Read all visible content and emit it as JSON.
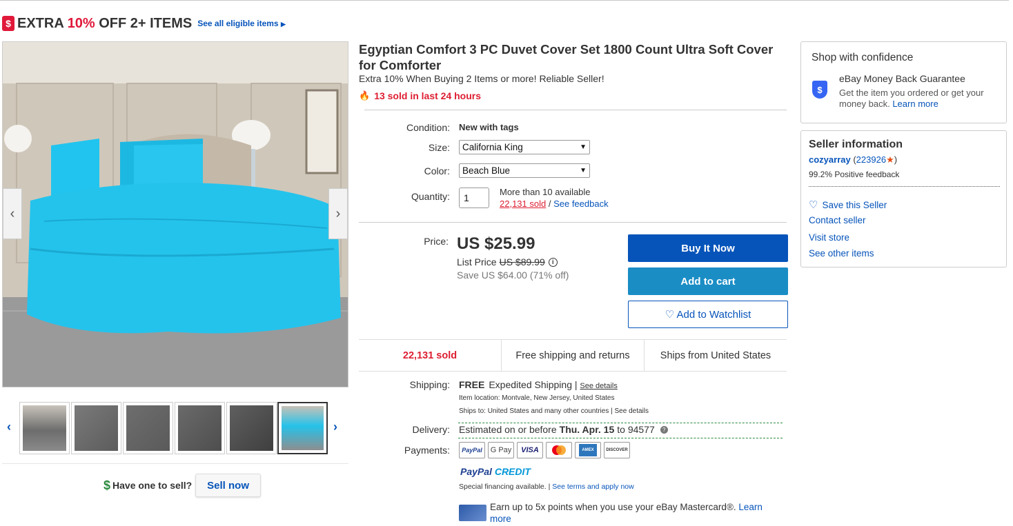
{
  "promo": {
    "text_pre": "EXTRA ",
    "text_pct": "10%",
    "text_post": " OFF 2+ ITEMS",
    "eligible_link": "See all eligible items",
    "icon": "$"
  },
  "product": {
    "title": "Egyptian Comfort 3 PC Duvet Cover Set 1800 Count Ultra Soft Cover for Comforter",
    "subtitle": "Extra 10% When Buying 2 Items or more! Reliable Seller!",
    "sold_24": "13 sold in last 24 hours"
  },
  "options": {
    "condition_label": "Condition:",
    "condition_value": "New with tags",
    "size_label": "Size:",
    "size_value": "California King",
    "color_label": "Color:",
    "color_value": "Beach Blue",
    "quantity_label": "Quantity:",
    "quantity_value": "1",
    "available": "More than 10 available",
    "sold_link": "22,131 sold",
    "slash": " / ",
    "feedback_link": "See feedback"
  },
  "pricing": {
    "price_label": "Price:",
    "price": "US $25.99",
    "list_price_label": "List Price",
    "list_price": "US $89.99",
    "save": "Save US $64.00 (71% off)"
  },
  "actions": {
    "buy_now": "Buy It Now",
    "add_to_cart": "Add to cart",
    "watchlist": "♡ Add to Watchlist"
  },
  "strip": {
    "sold": "22,131 sold",
    "shipping": "Free shipping and returns",
    "ships_from": "Ships from United States"
  },
  "shipping": {
    "label": "Shipping:",
    "free": "FREE",
    "method": "Expedited Shipping | ",
    "see_details": "See details",
    "location": "Item location:  Montvale, New Jersey, United States",
    "ships_to_pre": "Ships to:  United States and many other countries | ",
    "ships_to_link": "See details"
  },
  "delivery": {
    "label": "Delivery:",
    "pre": "Estimated on or before",
    "date": "Thu. Apr. 15",
    "post": "to 94577",
    "help": "?"
  },
  "payments": {
    "label": "Payments:",
    "methods": [
      "PayPal",
      "G Pay",
      "VISA",
      "Mastercard",
      "AMERICAN EXPRESS",
      "DISCOVER"
    ],
    "credit_pp": "PayPal",
    "credit_word": "CREDIT",
    "special": "Special financing available.  |  ",
    "terms_link": "See terms and apply now",
    "mastercard_text": "Earn up to 5x points when you use your eBay Mastercard®. ",
    "learn_more": "Learn more"
  },
  "gallery": {
    "prev": "‹",
    "next": "›",
    "thumb_prev": "‹",
    "thumb_next": "›"
  },
  "sell": {
    "question": "Have one to sell?",
    "button": "Sell now",
    "icon": "$"
  },
  "confidence": {
    "title": "Shop with confidence",
    "guarantee_title": "eBay Money Back Guarantee",
    "guarantee_desc": "Get the item you ordered or get your money back. ",
    "learn_more": "Learn more",
    "icon": "$"
  },
  "seller": {
    "title": "Seller information",
    "username": "cozyarray",
    "open_paren": " (",
    "score": "223926",
    "close_paren": ")",
    "star": "★",
    "feedback": "99.2% Positive feedback",
    "save_seller": "Save this Seller",
    "contact": "Contact seller",
    "visit_store": "Visit store",
    "other_items": "See other items"
  },
  "colors": {
    "accent_blue": "#0654ba",
    "cart_blue": "#1a8dc5",
    "red": "#dd1e31",
    "bedding": "#1fc0e9"
  }
}
